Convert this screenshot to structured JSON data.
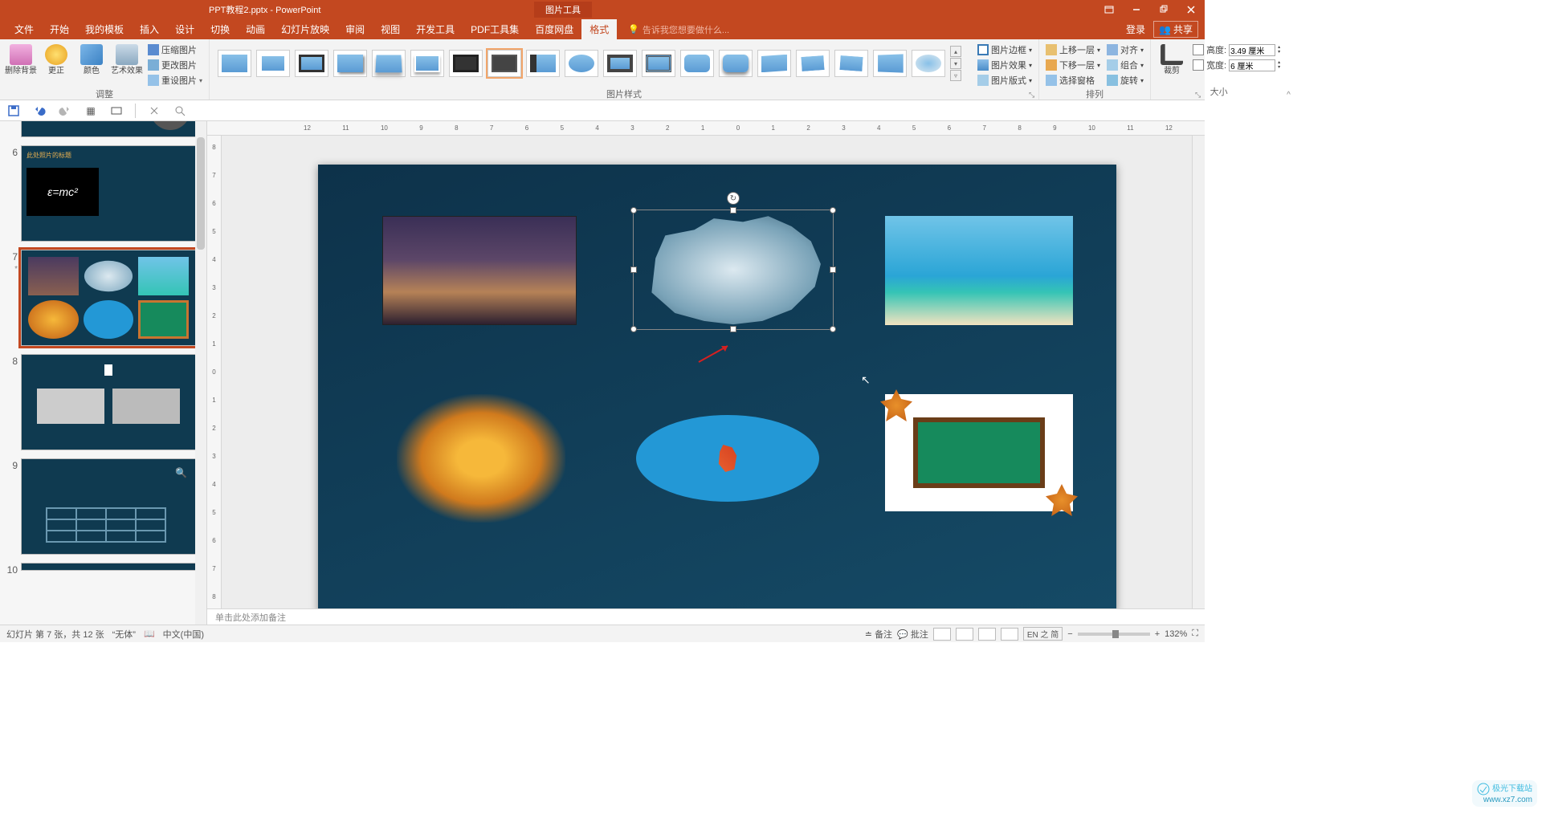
{
  "titlebar": {
    "title": "PPT教程2.pptx - PowerPoint",
    "context_tab": "图片工具"
  },
  "menu": {
    "tabs": [
      "文件",
      "开始",
      "我的模板",
      "插入",
      "设计",
      "切换",
      "动画",
      "幻灯片放映",
      "审阅",
      "视图",
      "开发工具",
      "PDF工具集",
      "百度网盘",
      "格式"
    ],
    "active_index": 13,
    "tell_me": "告诉我您想要做什么...",
    "login": "登录",
    "share": "共享"
  },
  "ribbon": {
    "adjust": {
      "remove_bg": "删除背景",
      "corrections": "更正",
      "color": "颜色",
      "artistic": "艺术效果",
      "compress": "压缩图片",
      "change": "更改图片",
      "reset": "重设图片",
      "group_label": "调整"
    },
    "styles": {
      "group_label": "图片样式"
    },
    "border": "图片边框",
    "effects": "图片效果",
    "layout": "图片版式",
    "arrange": {
      "bring_fwd": "上移一层",
      "send_back": "下移一层",
      "sel_pane": "选择窗格",
      "align": "对齐",
      "group": "组合",
      "rotate": "旋转",
      "group_label": "排列"
    },
    "size": {
      "crop": "裁剪",
      "height_lbl": "高度:",
      "height_val": "3.49 厘米",
      "width_lbl": "宽度:",
      "width_val": "6 厘米",
      "group_label": "大小"
    }
  },
  "ruler_marks": [
    "12",
    "11",
    "10",
    "9",
    "8",
    "7",
    "6",
    "5",
    "4",
    "3",
    "2",
    "1",
    "0",
    "1",
    "2",
    "3",
    "4",
    "5",
    "6",
    "7",
    "8",
    "9",
    "10",
    "11",
    "12"
  ],
  "ruler_v": [
    "8",
    "7",
    "6",
    "5",
    "4",
    "3",
    "2",
    "1",
    "0",
    "1",
    "2",
    "3",
    "4",
    "5",
    "6",
    "7",
    "8"
  ],
  "thumbs": {
    "s6_title": "此处照片的标题",
    "s6_eq": "ε=mc²",
    "nums": [
      "6",
      "7",
      "8",
      "9",
      "10"
    ],
    "current_star": "*"
  },
  "notes": {
    "placeholder": "单击此处添加备注"
  },
  "status": {
    "slide_info": "幻灯片 第 7 张，共 12 张",
    "lang_quote": "“无体”",
    "lang": "中文(中国)",
    "notes_btn": "备注",
    "comments_btn": "批注",
    "zoom": "132%",
    "ime": "EN 之 简"
  },
  "watermark": {
    "line1": "极光下载站",
    "line2": "www.xz7.com"
  }
}
